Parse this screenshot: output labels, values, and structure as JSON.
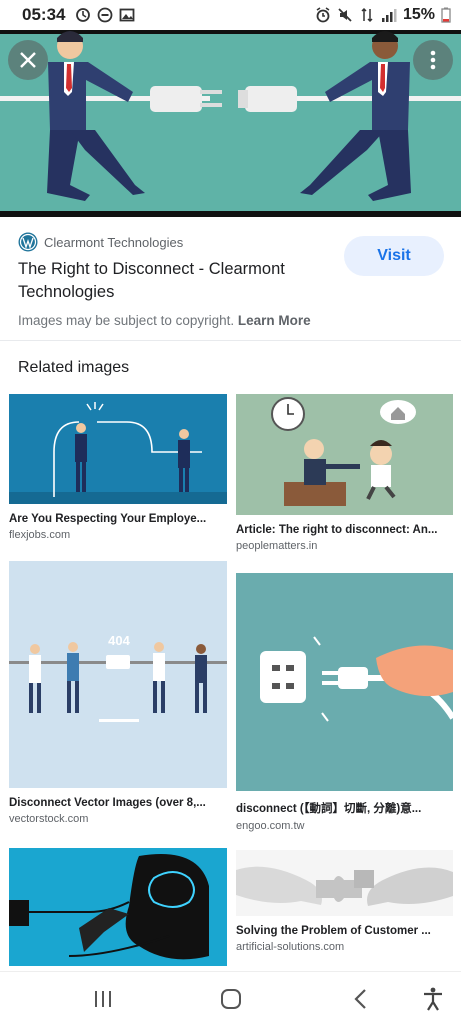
{
  "status_bar": {
    "time": "05:34",
    "battery": "15%",
    "left_icons": [
      "sync-icon",
      "dnd-icon",
      "gallery-icon"
    ],
    "right_icons": [
      "alarm-icon",
      "mute-icon",
      "data-icon",
      "signal-icon",
      "battery-icon"
    ]
  },
  "detail": {
    "source": "Clearmont Technologies",
    "title": "The Right to Disconnect - Clearmont Technologies",
    "visit_label": "Visit",
    "copyright_notice": "Images may be subject to copyright.",
    "learn_more": "Learn More"
  },
  "related": {
    "heading": "Related images",
    "items": [
      {
        "caption": "Are You Respecting Your Employe...",
        "site": "flexjobs.com"
      },
      {
        "caption": "Article: The right to disconnect: An...",
        "site": "peoplematters.in"
      },
      {
        "caption": "Disconnect Vector Images (over 8,...",
        "site": "vectorstock.com",
        "image_text": "404"
      },
      {
        "caption": "disconnect (【動詞】切斷, 分離)意...",
        "site": "engoo.com.tw"
      },
      {
        "caption": "",
        "site": ""
      },
      {
        "caption": "Solving the Problem of Customer ...",
        "site": "artificial-solutions.com"
      }
    ]
  },
  "nav_bar": {
    "icons": [
      "recent-apps-icon",
      "home-icon",
      "back-icon",
      "accessibility-icon"
    ]
  },
  "colors": {
    "accent": "#1a73e8",
    "visit_bg": "#e8f0fe",
    "hero_bg": "#5fb3a7"
  }
}
